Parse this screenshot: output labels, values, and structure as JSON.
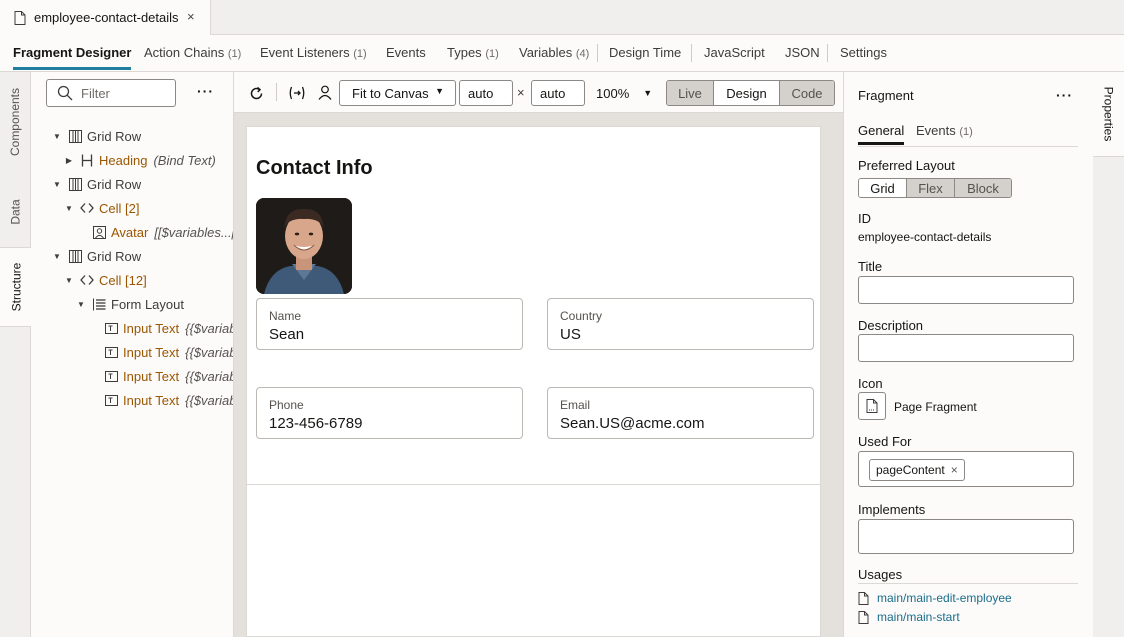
{
  "file_tab": {
    "name": "employee-contact-details",
    "close": "×"
  },
  "editor_tabs": [
    {
      "label": "Fragment Designer",
      "count": ""
    },
    {
      "label": "Action Chains",
      "count": "(1)"
    },
    {
      "label": "Event Listeners",
      "count": "(1)"
    },
    {
      "label": "Events",
      "count": ""
    },
    {
      "label": "Types",
      "count": "(1)"
    },
    {
      "label": "Variables",
      "count": "(4)"
    },
    {
      "label": "Design Time",
      "count": ""
    },
    {
      "label": "JavaScript",
      "count": ""
    },
    {
      "label": "JSON",
      "count": ""
    },
    {
      "label": "Settings",
      "count": ""
    }
  ],
  "left_rail": {
    "components": "Components",
    "data": "Data",
    "structure": "Structure"
  },
  "right_rail": {
    "properties": "Properties"
  },
  "structure": {
    "filter_placeholder": "Filter",
    "more": "···",
    "tree": [
      {
        "label": "Grid Row",
        "extra": ""
      },
      {
        "label": "Heading",
        "extra": "(Bind Text)"
      },
      {
        "label": "Grid Row",
        "extra": ""
      },
      {
        "label": "Cell [2]",
        "extra": ""
      },
      {
        "label": "Avatar",
        "extra": "[[$variables...pi"
      },
      {
        "label": "Grid Row",
        "extra": ""
      },
      {
        "label": "Cell [12]",
        "extra": ""
      },
      {
        "label": "Form Layout",
        "extra": ""
      },
      {
        "label": "Input Text",
        "extra": "{{$variab"
      },
      {
        "label": "Input Text",
        "extra": "{{$variab"
      },
      {
        "label": "Input Text",
        "extra": "{{$variab"
      },
      {
        "label": "Input Text",
        "extra": "{{$variab"
      }
    ]
  },
  "toolbar": {
    "fit": "Fit to Canvas",
    "width": "auto",
    "times": "×",
    "height": "auto",
    "zoom": "100%",
    "modes": [
      "Live",
      "Design",
      "Code"
    ]
  },
  "canvas": {
    "title": "Contact Info",
    "fields": [
      {
        "label": "Name",
        "value": "Sean"
      },
      {
        "label": "Country",
        "value": "US"
      },
      {
        "label": "Phone",
        "value": "123-456-6789"
      },
      {
        "label": "Email",
        "value": "Sean.US@acme.com"
      }
    ]
  },
  "properties": {
    "title": "Fragment",
    "more": "···",
    "tabs": [
      {
        "label": "General",
        "count": ""
      },
      {
        "label": "Events",
        "count": "(1)"
      }
    ],
    "preferred_layout_label": "Preferred Layout",
    "layouts": [
      "Grid",
      "Flex",
      "Block"
    ],
    "id_label": "ID",
    "id_value": "employee-contact-details",
    "title_label": "Title",
    "description_label": "Description",
    "icon_label": "Icon",
    "icon_value": "Page Fragment",
    "used_for_label": "Used For",
    "used_for_chip": "pageContent",
    "chip_remove": "×",
    "implements_label": "Implements",
    "usages_label": "Usages",
    "usages": [
      "main/main-edit-employee",
      "main/main-start"
    ]
  },
  "colors": {
    "accent": "#227e9e",
    "component": "#9a5600",
    "link": "#1a6d8c"
  }
}
